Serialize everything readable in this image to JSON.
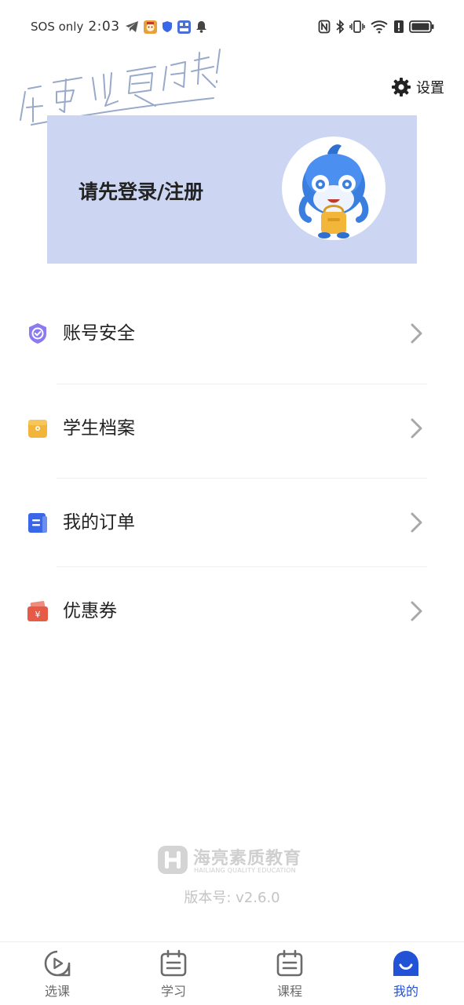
{
  "status_bar": {
    "carrier": "SOS only",
    "time": "2:03"
  },
  "handwriting_text": "你可以更优秀!",
  "settings": {
    "label": "设置",
    "icon": "gear-icon"
  },
  "banner": {
    "login_text": "请先登录/注册",
    "avatar": "mascot-avatar",
    "color": "#ccd6f3"
  },
  "menu": {
    "items": [
      {
        "label": "账号安全",
        "icon": "shield-check-icon",
        "color": "#8a7cf0"
      },
      {
        "label": "学生档案",
        "icon": "folder-icon",
        "color": "#f3b43c"
      },
      {
        "label": "我的订单",
        "icon": "order-doc-icon",
        "color": "#3a66e8"
      },
      {
        "label": "优惠券",
        "icon": "coupon-icon",
        "color": "#e65a48"
      }
    ]
  },
  "footer": {
    "brand_cn": "海亮素质教育",
    "brand_en": "HAILIANG QUALITY EDUCATION",
    "version": "版本号: v2.6.0"
  },
  "tabbar": {
    "tabs": [
      {
        "label": "选课",
        "icon": "play-circle-icon"
      },
      {
        "label": "学习",
        "icon": "calendar-icon"
      },
      {
        "label": "课程",
        "icon": "calendar-icon"
      },
      {
        "label": "我的",
        "icon": "smile-face-icon",
        "active": true
      }
    ],
    "accent": "#2253d6"
  }
}
